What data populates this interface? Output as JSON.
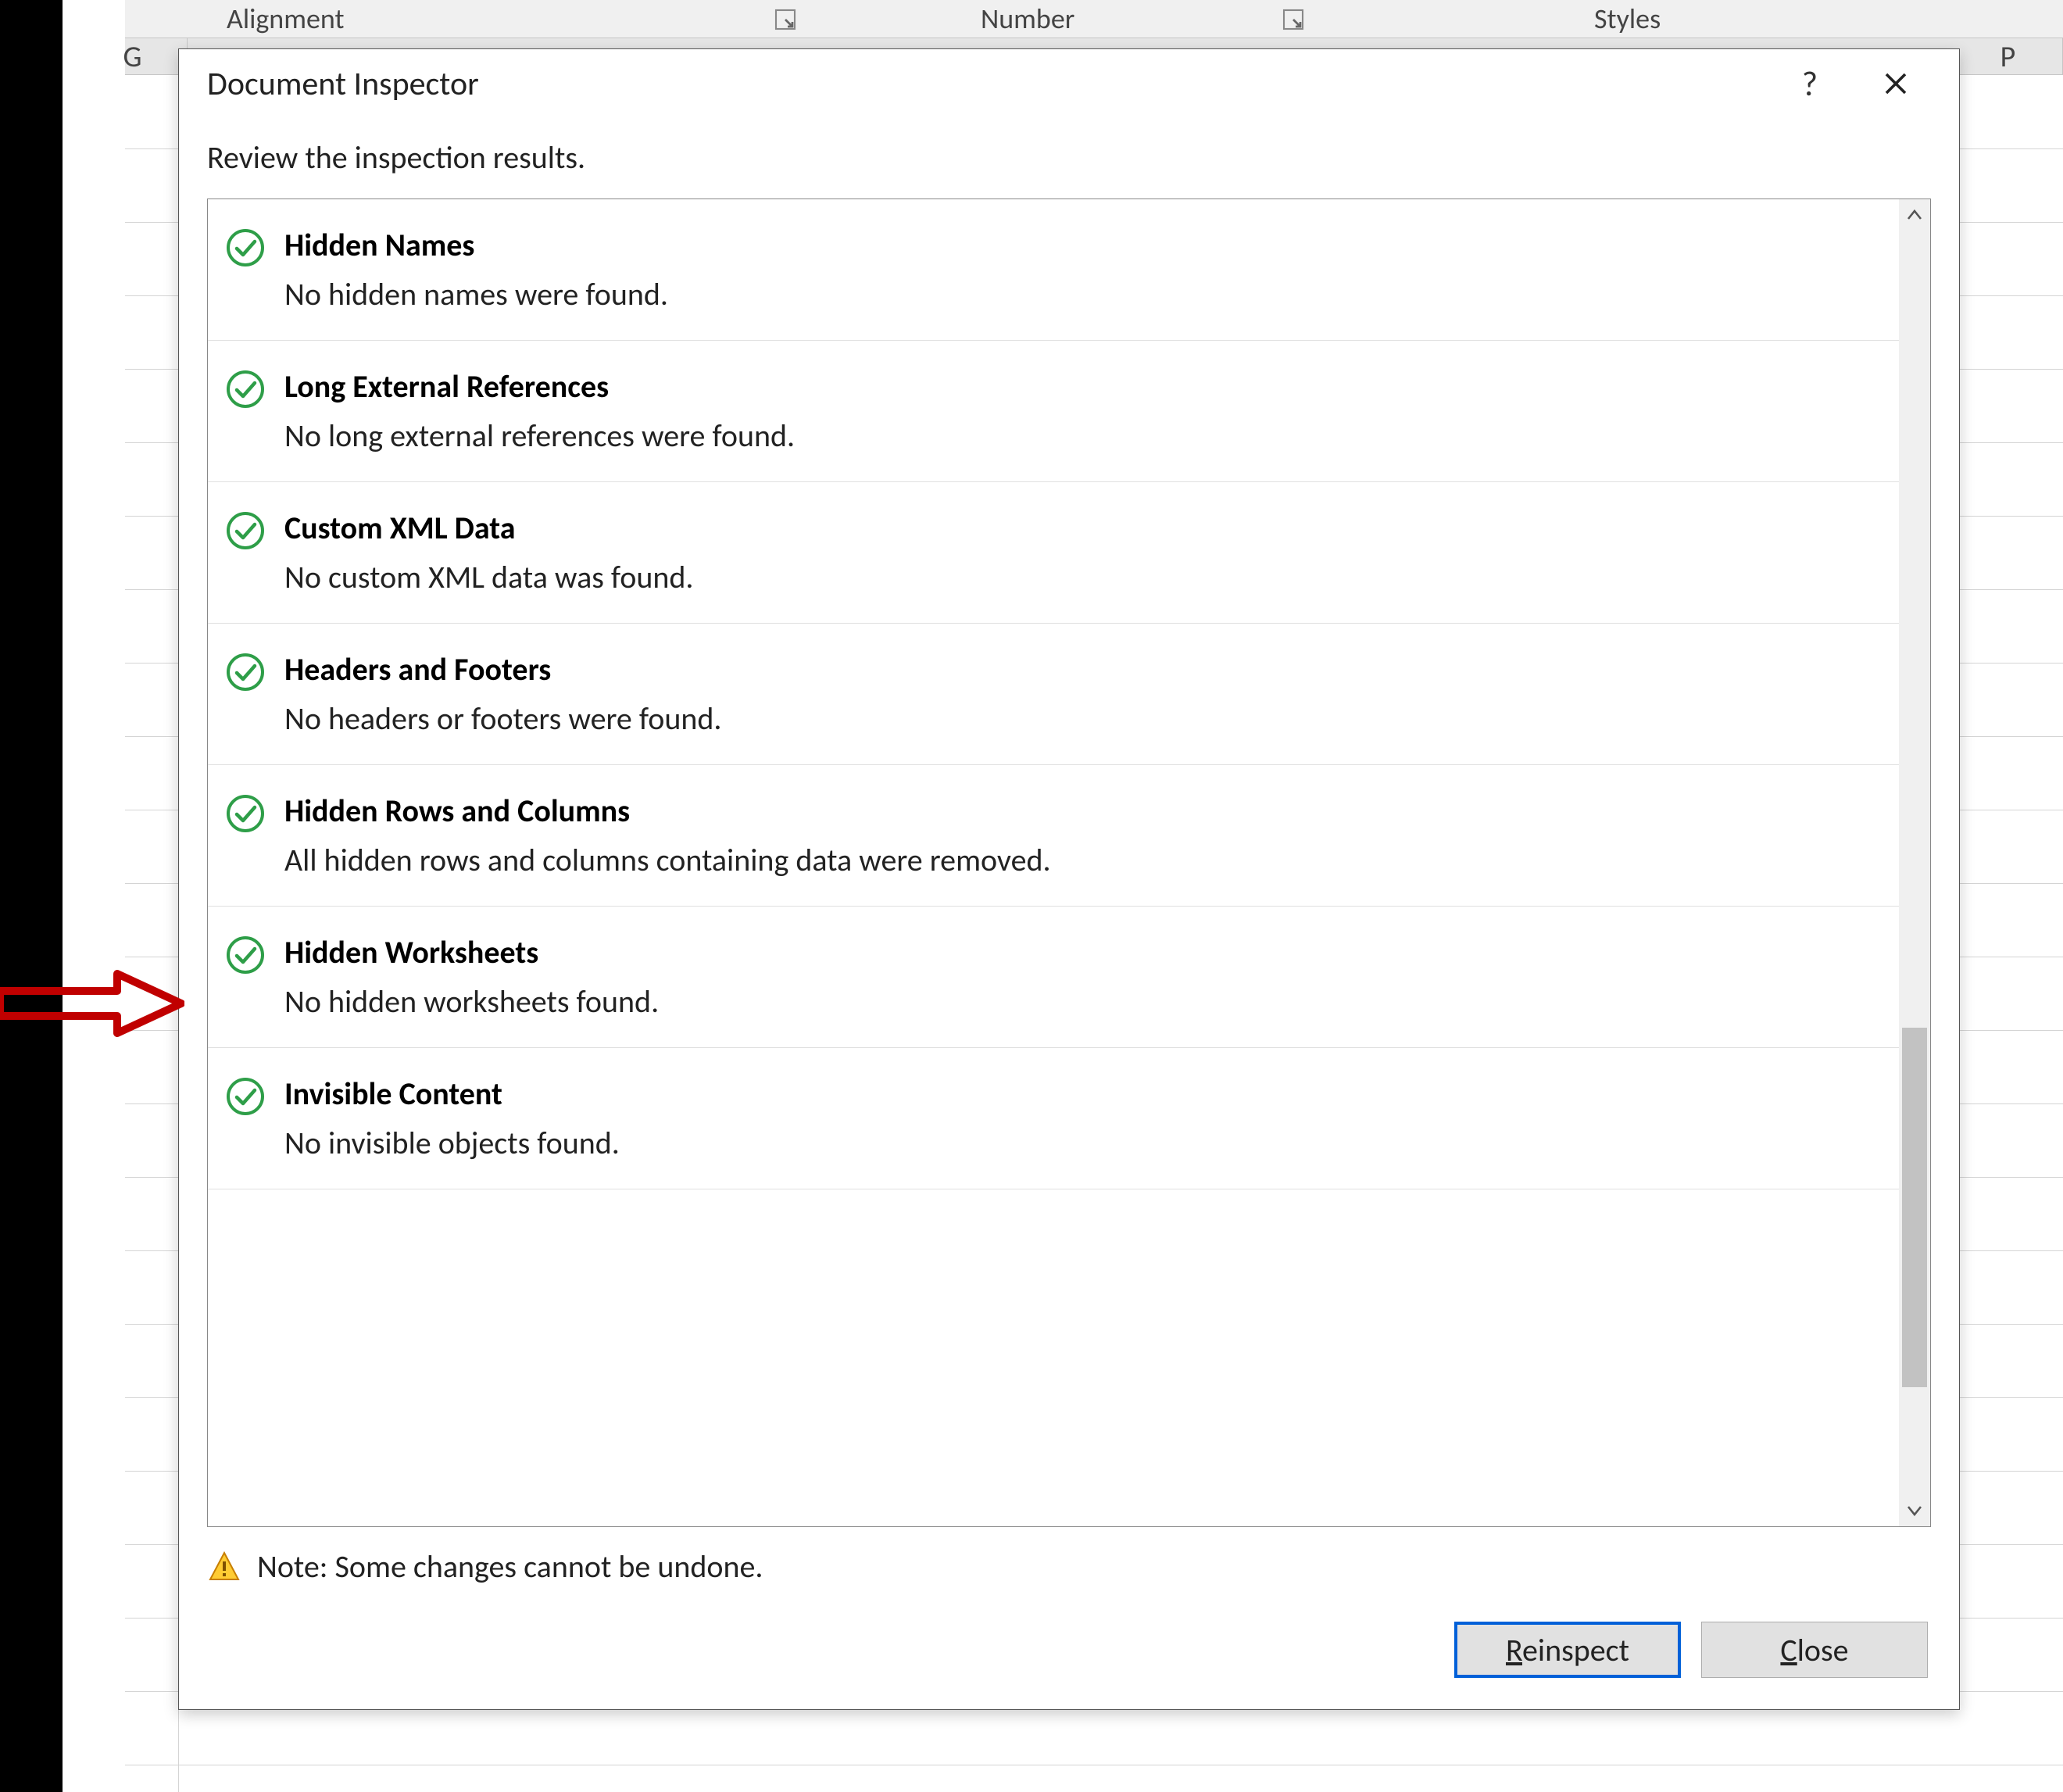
{
  "ribbon": {
    "alignment": "Alignment",
    "number": "Number",
    "styles": "Styles"
  },
  "columns": {
    "g": "G",
    "p": "P"
  },
  "dialog": {
    "title": "Document Inspector",
    "instruction": "Review the inspection results.",
    "note": "Note: Some changes cannot be undone.",
    "reinspect_r": "R",
    "reinspect_rest": "einspect",
    "close_c": "C",
    "close_rest": "lose"
  },
  "results": [
    {
      "title": "Hidden Names",
      "desc": "No hidden names were found."
    },
    {
      "title": "Long External References",
      "desc": "No long external references were found."
    },
    {
      "title": "Custom XML Data",
      "desc": "No custom XML data was found."
    },
    {
      "title": "Headers and Footers",
      "desc": "No headers or footers were found."
    },
    {
      "title": "Hidden Rows and Columns",
      "desc": "All hidden rows and columns containing data were removed."
    },
    {
      "title": "Hidden Worksheets",
      "desc": "No hidden worksheets found."
    },
    {
      "title": "Invisible Content",
      "desc": "No invisible objects found."
    }
  ]
}
